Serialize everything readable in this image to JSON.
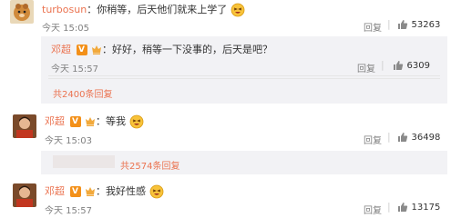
{
  "comments": [
    {
      "user": "turbosun",
      "text": "：你稍等，后天他们就来上学了",
      "time": "今天 15:05",
      "reply_label": "回复",
      "like_count": "53263"
    },
    {
      "user": "邓超",
      "text": "：好好，稍等一下没事的，后天是吧？",
      "time": "今天 15:57",
      "reply_label": "回复",
      "like_count": "6309",
      "more_replies": "共2400条回复"
    },
    {
      "user": "邓超",
      "text": "：等我",
      "time": "今天 15:03",
      "reply_label": "回复",
      "like_count": "36498",
      "more_replies": "共2574条回复"
    },
    {
      "user": "邓超",
      "text": "：我好性感",
      "time": "今天 15:57",
      "reply_label": "回复",
      "like_count": "13175"
    }
  ],
  "badge_v": "V",
  "icons": {
    "like": "thumbs-up-icon",
    "verified": "verified-v-icon",
    "level": "member-level-icon",
    "emoji": "laughing-emoji-icon"
  },
  "colors": {
    "username": "#eb7350",
    "nested_bg": "#f2f2f5",
    "badge": "#f39019"
  }
}
